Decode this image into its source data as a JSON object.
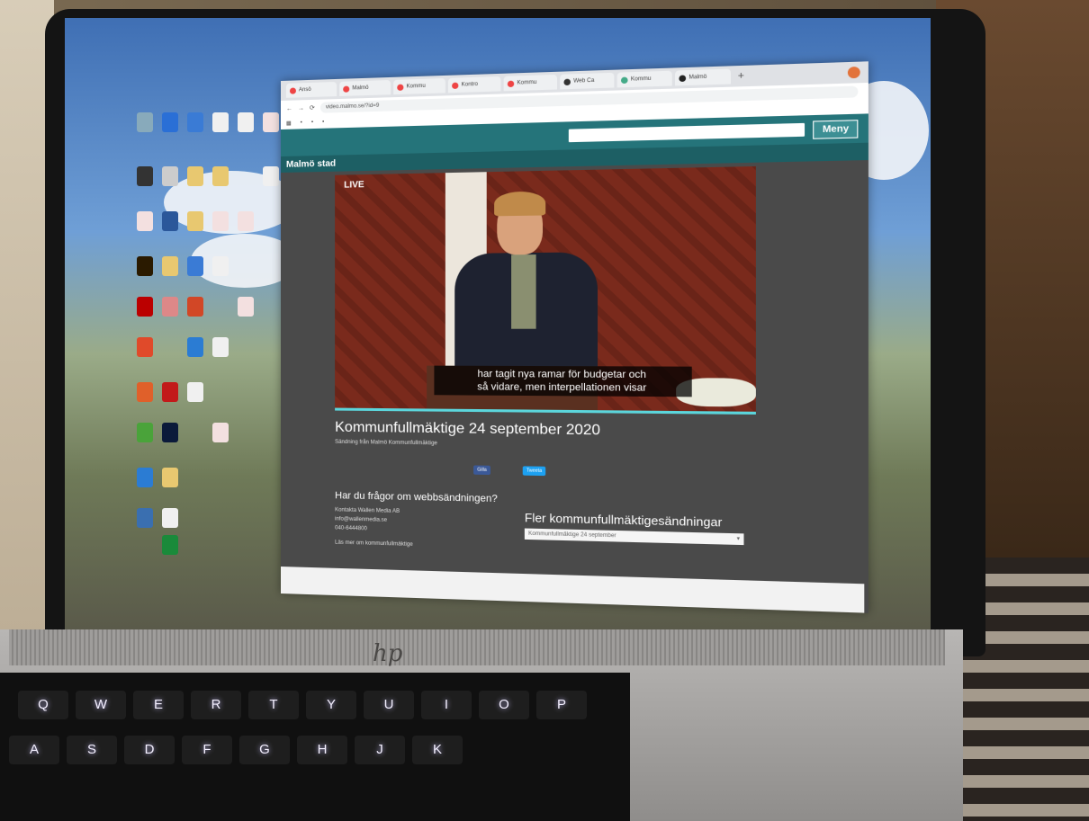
{
  "browser": {
    "tabs": [
      {
        "label": "Ansö"
      },
      {
        "label": "Malmö"
      },
      {
        "label": "Kommu"
      },
      {
        "label": "Kontro"
      },
      {
        "label": "Kommu"
      },
      {
        "label": "Web Ca"
      },
      {
        "label": "Kommu"
      },
      {
        "label": "Malmö"
      }
    ],
    "url": "video.malmo.se/?id=9"
  },
  "site": {
    "brand": "Malmö stad",
    "menu_label": "Meny",
    "player": {
      "live_label": "LIVE",
      "subtitle_line1": "har tagit nya ramar för budgetar och",
      "subtitle_line2": "så vidare, men interpellationen visar"
    },
    "title": "Kommunfullmäktige 24 september 2020",
    "subline": "Sändning från Malmö Kommunfullmäktige",
    "share_fb": "Gilla",
    "share_tw": "Tweeta",
    "questions": {
      "title": "Har du frågor om webbsändningen?",
      "contact": "Kontakta Wallen Media AB",
      "email": "info@wallenmedia.se",
      "phone": "040-6444800",
      "read_more": "Läs mer om kommunfullmäktige"
    },
    "more": {
      "title": "Fler kommunfullmäktigesändningar",
      "selected": "Kommunfullmäktige 24 september"
    }
  },
  "laptop": {
    "logo": "hp"
  },
  "keyboard": {
    "keys": [
      "Q",
      "W",
      "E",
      "R",
      "T",
      "Y",
      "U",
      "I",
      "O",
      "P",
      "A",
      "S",
      "D",
      "F",
      "G",
      "H",
      "J",
      "K"
    ]
  },
  "colors": {
    "site_header": "#25747a",
    "accent": "#5bd6dc"
  }
}
